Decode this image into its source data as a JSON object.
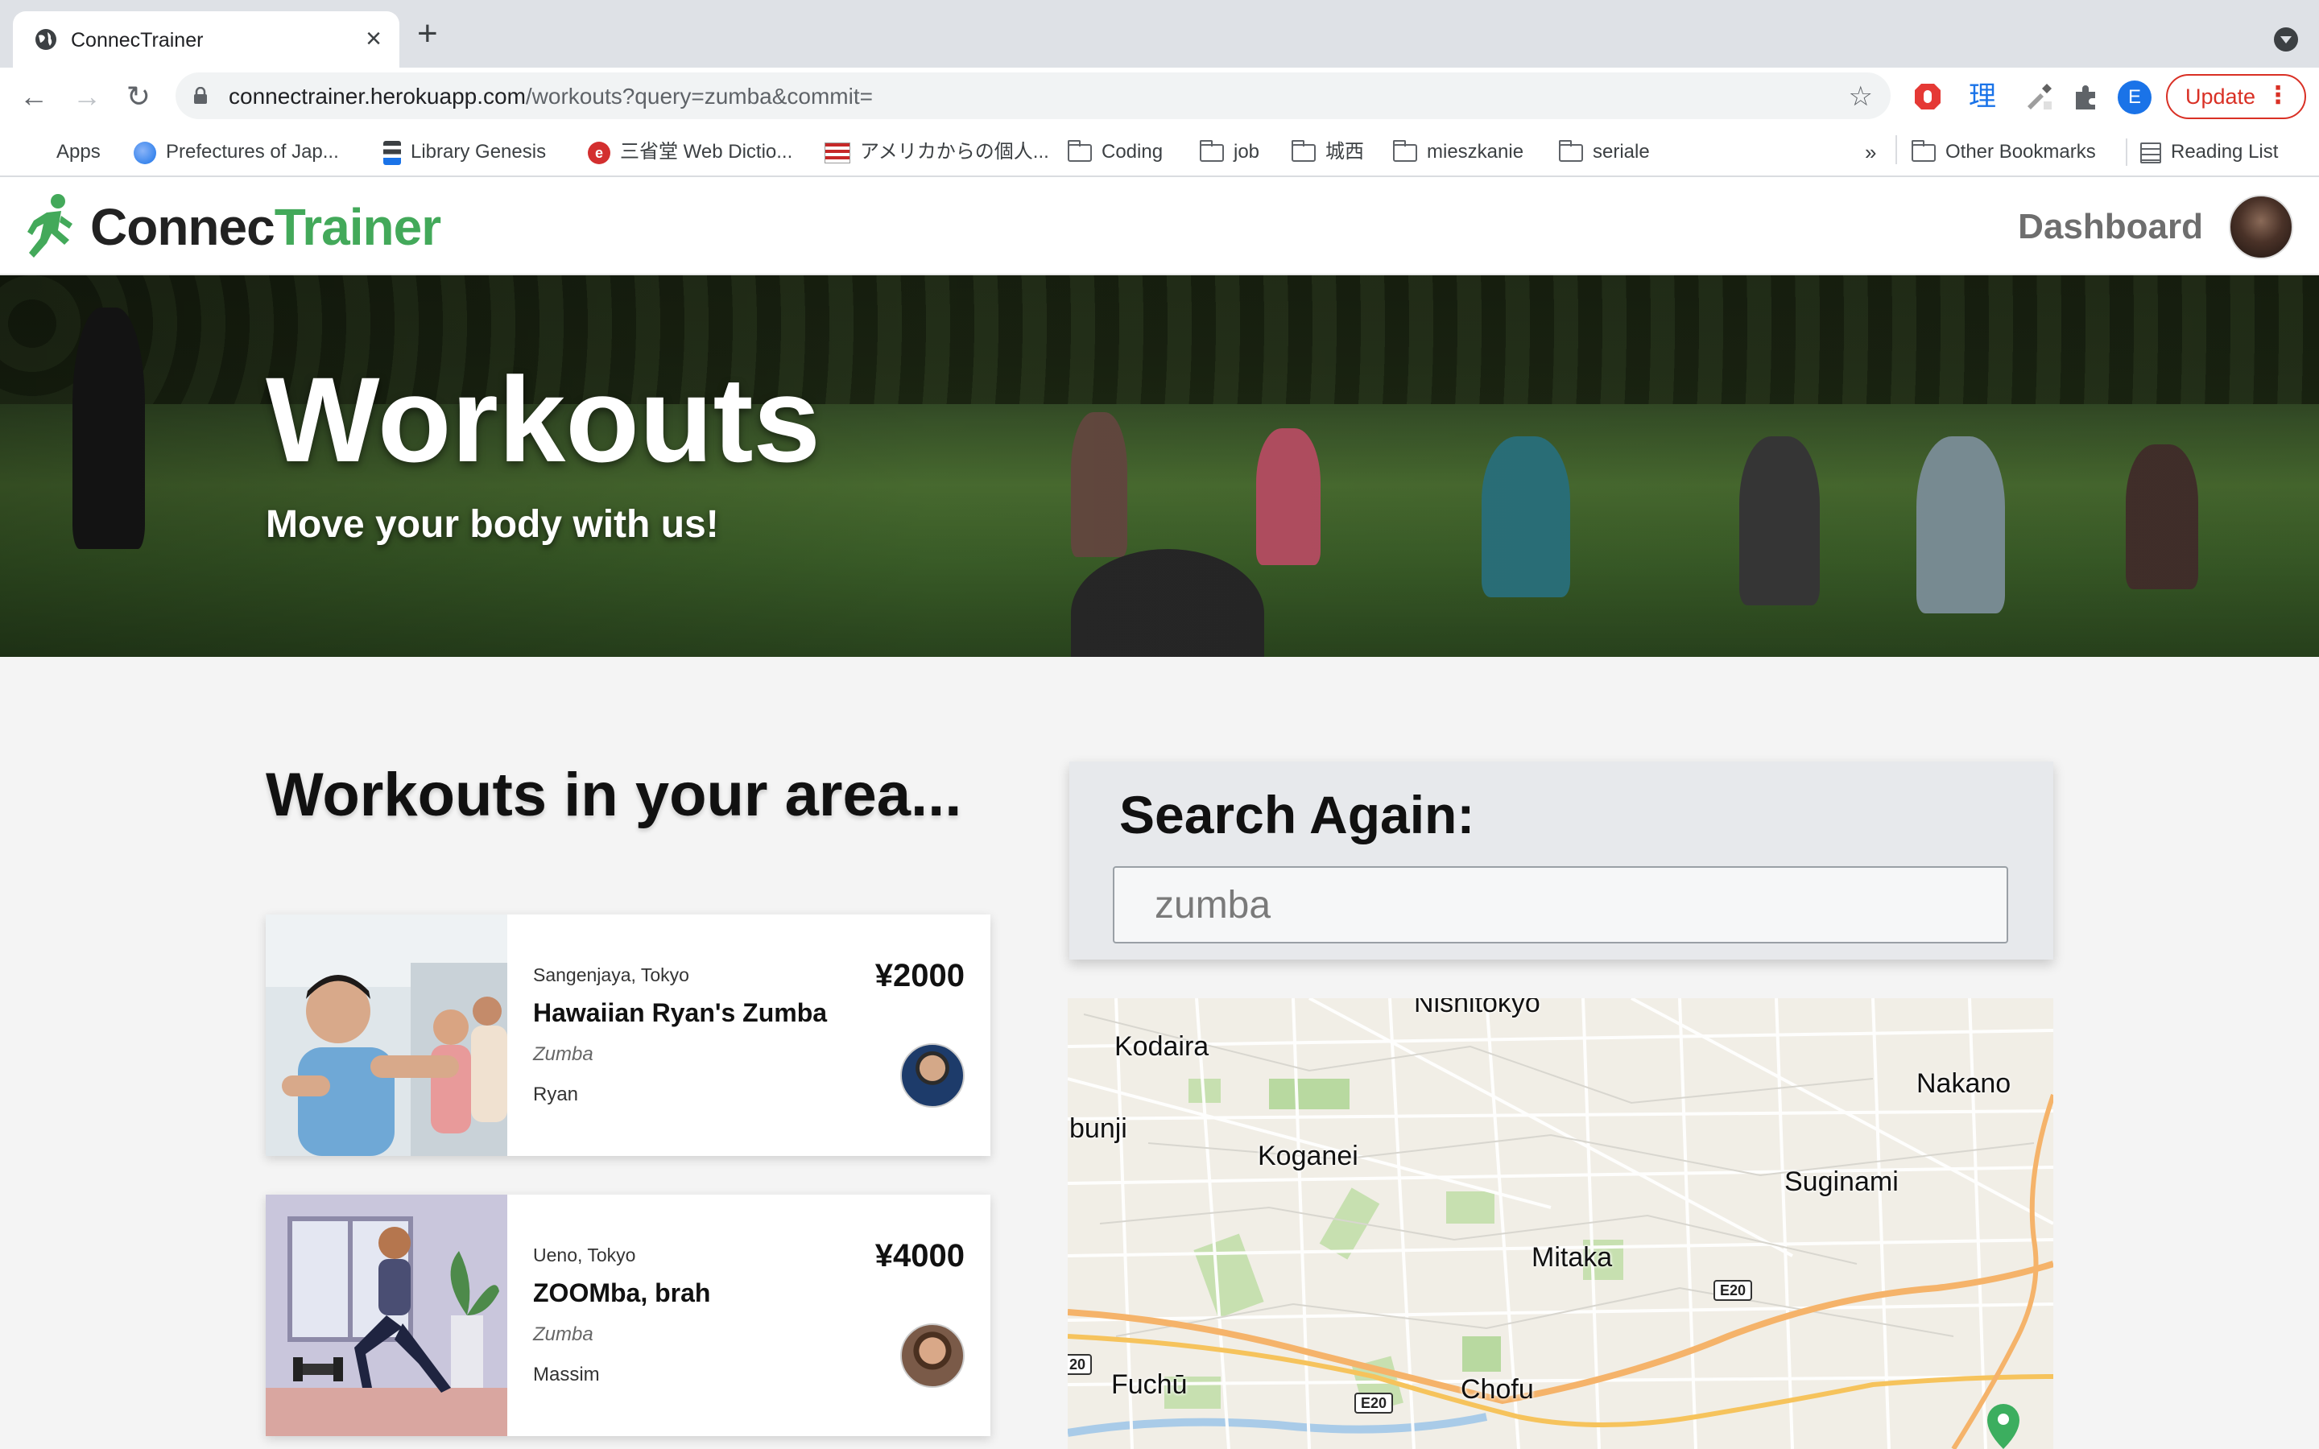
{
  "browser": {
    "tab_title": "ConnecTrainer",
    "url_host": "connectrainer.herokuapp.com",
    "url_rest": "/workouts?query=zumba&commit=",
    "update_label": "Update",
    "profile_initial": "E",
    "bookmarks": [
      {
        "label": "Apps",
        "icon": "apps-grid-icon"
      },
      {
        "label": "Prefectures of Jap...",
        "icon": "globe-icon"
      },
      {
        "label": "Library Genesis",
        "icon": "libgen-icon"
      },
      {
        "label": "三省堂 Web Dictio...",
        "icon": "sanseido-icon"
      },
      {
        "label": "アメリカからの個人...",
        "icon": "us-flag-icon"
      },
      {
        "label": "Coding",
        "icon": "folder-icon"
      },
      {
        "label": "job",
        "icon": "folder-icon"
      },
      {
        "label": "城西",
        "icon": "folder-icon"
      },
      {
        "label": "mieszkanie",
        "icon": "folder-icon"
      },
      {
        "label": "seriale",
        "icon": "folder-icon"
      }
    ],
    "overflow_label": "»",
    "other_bookmarks": "Other Bookmarks",
    "reading_list": "Reading List"
  },
  "site": {
    "logo_part1": "Connec",
    "logo_part2": "Trainer",
    "dashboard_label": "Dashboard"
  },
  "hero": {
    "title": "Workouts",
    "subtitle": "Move your body with us!"
  },
  "main": {
    "section_title": "Workouts in your area...",
    "workouts": [
      {
        "location": "Sangenjaya, Tokyo",
        "title": "Hawaiian Ryan's Zumba",
        "category": "Zumba",
        "trainer": "Ryan",
        "price": "¥2000"
      },
      {
        "location": "Ueno, Tokyo",
        "title": "ZOOMba, brah",
        "category": "Zumba",
        "trainer": "Massim",
        "price": "¥4000"
      }
    ]
  },
  "search": {
    "title": "Search Again:",
    "value": "zumba"
  },
  "map": {
    "labels": [
      "Nishitokyo",
      "Kodaira",
      "Nakano",
      "bunji",
      "Koganei",
      "Suginami",
      "Mitaka",
      "Fuchū",
      "Chofu"
    ],
    "shields": [
      "E20",
      "E20",
      "20"
    ]
  },
  "colors": {
    "brand_green": "#43a95a",
    "update_red": "#d93025"
  }
}
